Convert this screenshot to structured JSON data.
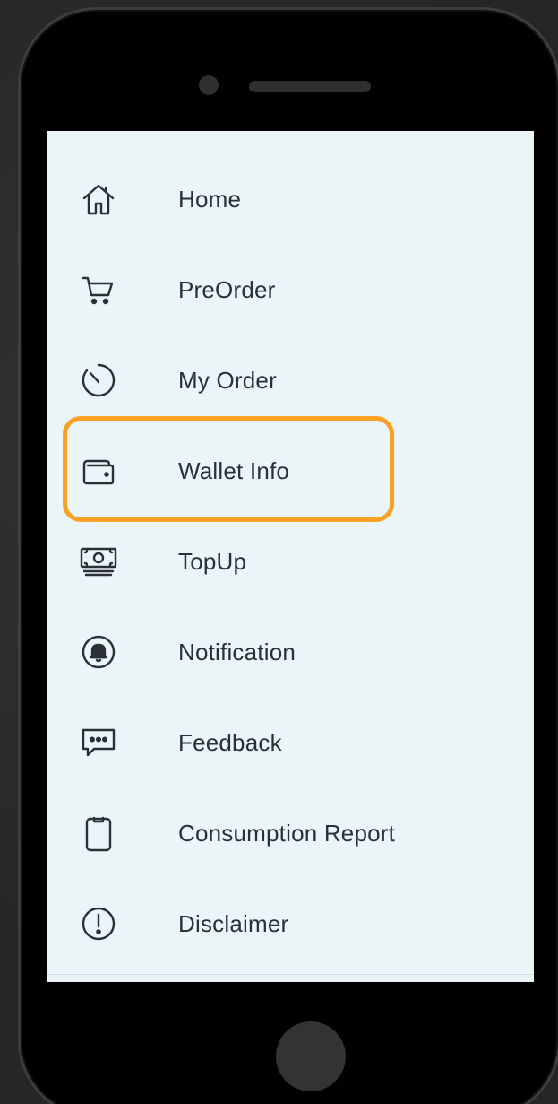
{
  "menu": {
    "items": [
      {
        "label": "Home",
        "icon": "home-icon"
      },
      {
        "label": "PreOrder",
        "icon": "cart-icon"
      },
      {
        "label": "My Order",
        "icon": "timer-icon"
      },
      {
        "label": "Wallet Info",
        "icon": "wallet-icon"
      },
      {
        "label": "TopUp",
        "icon": "money-icon"
      },
      {
        "label": "Notification",
        "icon": "bell-icon"
      },
      {
        "label": "Feedback",
        "icon": "chat-icon"
      },
      {
        "label": "Consumption Report",
        "icon": "clipboard-icon"
      },
      {
        "label": "Disclaimer",
        "icon": "alert-icon"
      }
    ],
    "highlighted": "Wallet Info"
  },
  "colors": {
    "screen_bg": "#ebf4f7",
    "text": "#2a2f38",
    "highlight": "#f7a126"
  }
}
